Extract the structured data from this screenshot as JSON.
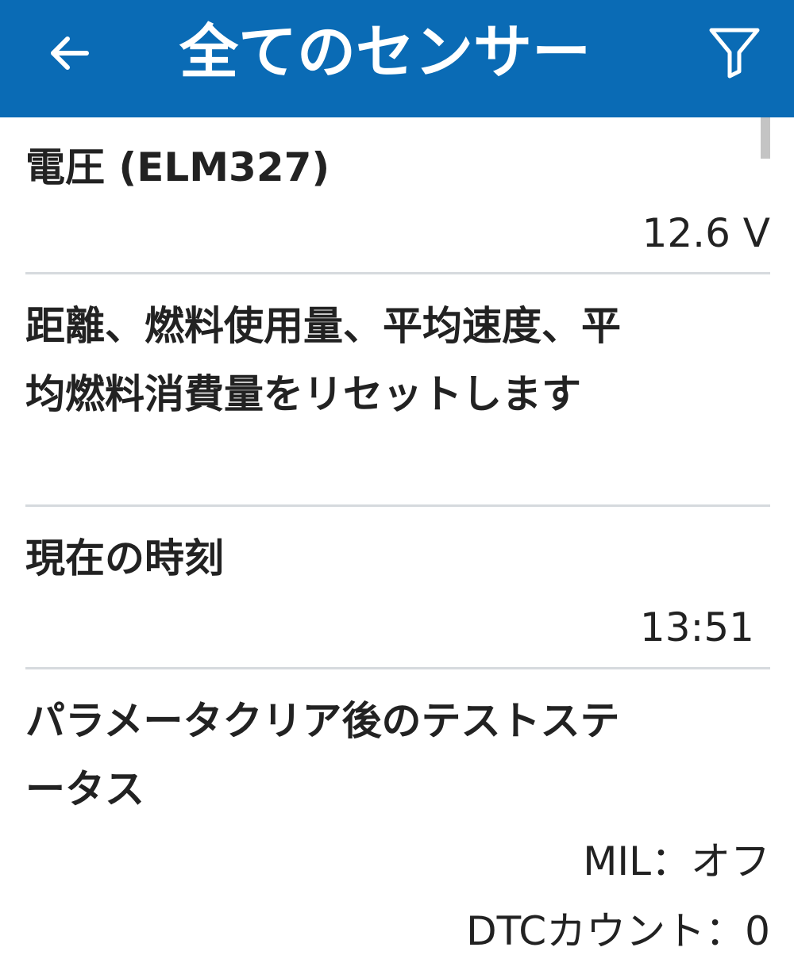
{
  "header": {
    "title": "全てのセンサー",
    "back_icon": "arrow-left-icon",
    "filter_icon": "filter-icon",
    "background_color": "#0a6bb5"
  },
  "sensors": [
    {
      "name": "電圧 (ELM327)",
      "value": "12.6 V"
    },
    {
      "name_line1": "距離、燃料使用量、平均速度、平",
      "name_line2": "均燃料消費量をリセットします"
    },
    {
      "name": "現在の時刻",
      "value": "13:51"
    },
    {
      "name_line1": "パラメータクリア後のテストステ",
      "name_line2": "ータス",
      "value_line1": "MIL：オフ",
      "value_line2": "DTCカウント：0"
    }
  ]
}
